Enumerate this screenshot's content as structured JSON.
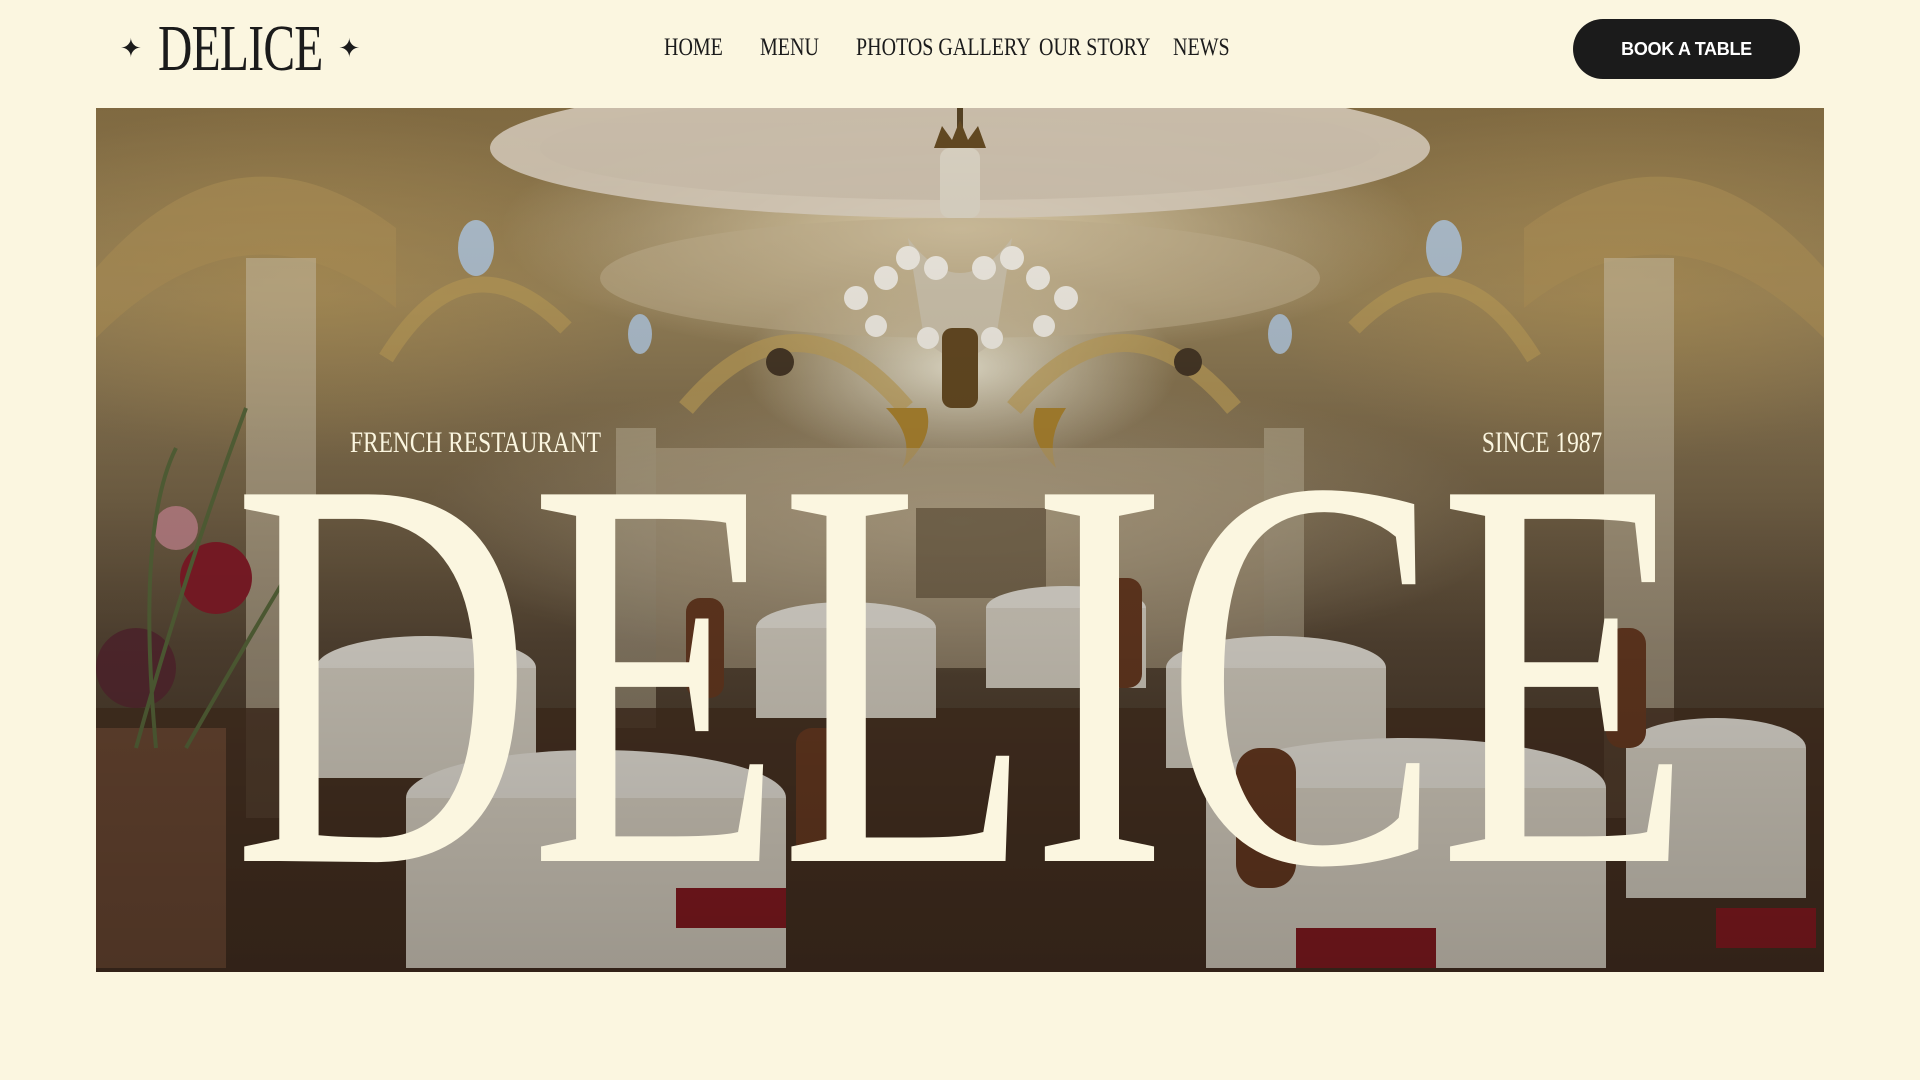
{
  "brand": {
    "logo_text": "DELICE",
    "logo_star": "✦"
  },
  "nav": {
    "items": [
      {
        "label": "HOME"
      },
      {
        "label": "MENU"
      },
      {
        "label": "PHOTOS GALLERY"
      },
      {
        "label": "OUR STORY"
      },
      {
        "label": "NEWS"
      }
    ],
    "cta_label": "BOOK A TABLE"
  },
  "hero": {
    "subtitle_left": "FRENCH RESTAURANT",
    "subtitle_right": "SINCE 1987",
    "title": "DELICE",
    "image_description": "ornate dining room with chandelier",
    "icons": [
      "star-icon",
      "chandelier-icon"
    ]
  },
  "colors": {
    "background": "#fbf6e0",
    "text_dark": "#1b1b1b",
    "button_bg": "#1b1b1b",
    "button_text": "#ffffff",
    "hero_text": "#fbf6e0"
  }
}
